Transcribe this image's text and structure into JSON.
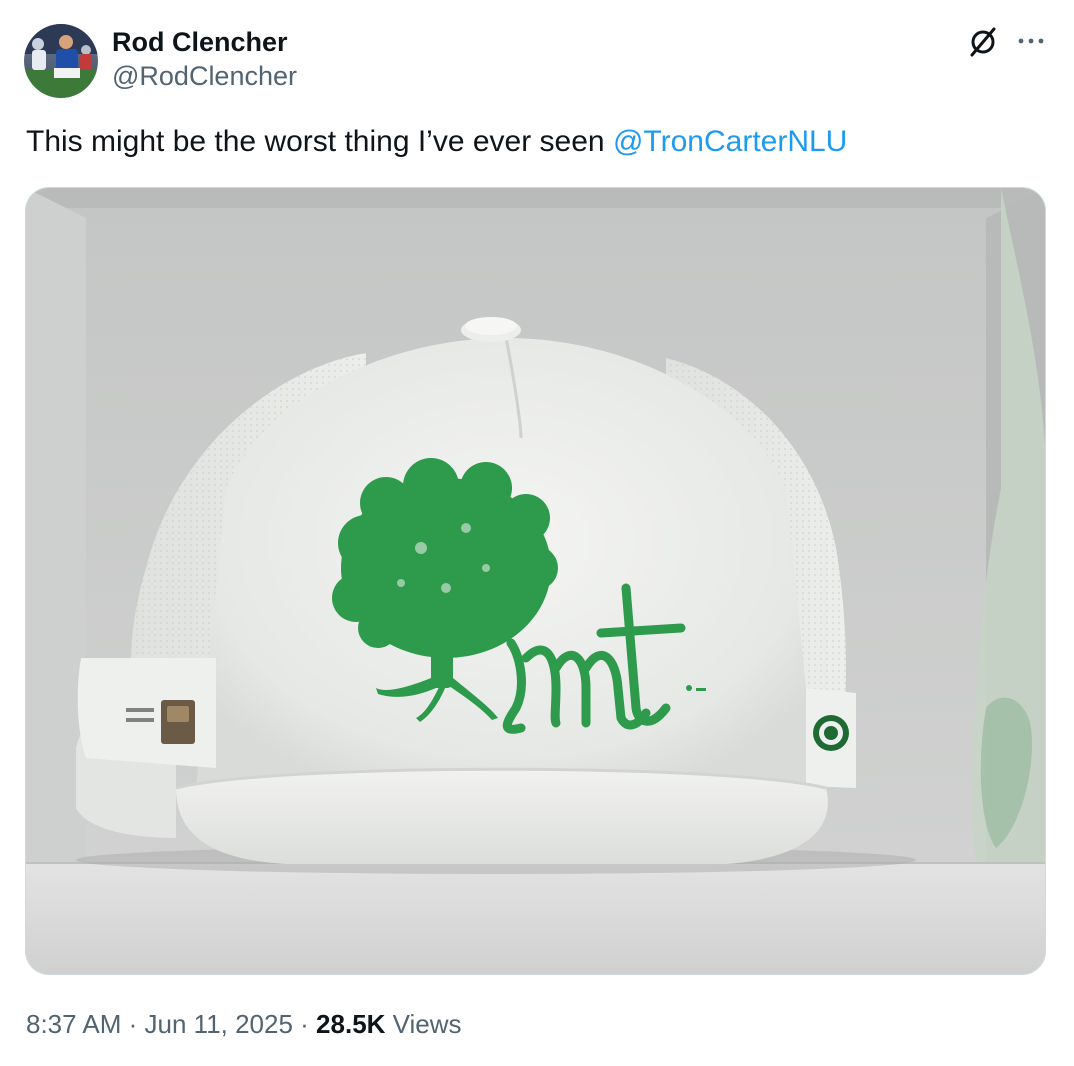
{
  "author": {
    "display_name": "Rod Clencher",
    "handle": "@RodClencher"
  },
  "icons": {
    "grok": "grok-icon",
    "more": "more-dots-icon"
  },
  "tweet": {
    "text": "This might be the worst thing I’ve ever seen ",
    "mention": "@TronCarterNLU"
  },
  "meta": {
    "time": "8:37 AM",
    "separator_1": " · ",
    "date": "Jun 11, 2025",
    "separator_2": " · ",
    "views_count": "28.5K",
    "views_label": " Views"
  },
  "colors": {
    "link": "#1d9bf0",
    "secondary_text": "#536471",
    "primary_text": "#0f1419",
    "embroidery_green": "#2e9a4c"
  }
}
